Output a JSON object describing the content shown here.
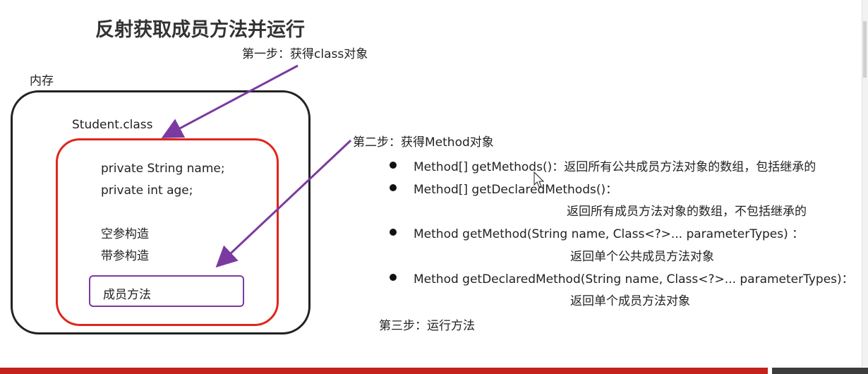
{
  "title": "反射获取成员方法并运行",
  "step1": "第一步：获得class对象",
  "step2": "第二步：获得Method对象",
  "step3": "第三步：运行方法",
  "memory": {
    "label": "内存",
    "class_label": "Student.class",
    "fields": [
      "private String name;",
      "private int age;"
    ],
    "constructors": [
      "空参构造",
      "带参构造"
    ],
    "methods_label": "成员方法"
  },
  "api": [
    {
      "sig": "Method[] getMethods()：返回所有公共成员方法对象的数组，包括继承的",
      "desc": ""
    },
    {
      "sig": "Method[] getDeclaredMethods()：",
      "desc": "返回所有成员方法对象的数组，不包括继承的"
    },
    {
      "sig": "Method getMethod(String name, Class<?>... parameterTypes) ：",
      "desc": "返回单个公共成员方法对象"
    },
    {
      "sig": "Method getDeclaredMethod(String name, Class<?>... parameterTypes)：",
      "desc": "返回单个成员方法对象"
    }
  ],
  "colors": {
    "arrow": "#7a3aa0",
    "class_border": "#e0261b",
    "bar": "#c4221c"
  }
}
